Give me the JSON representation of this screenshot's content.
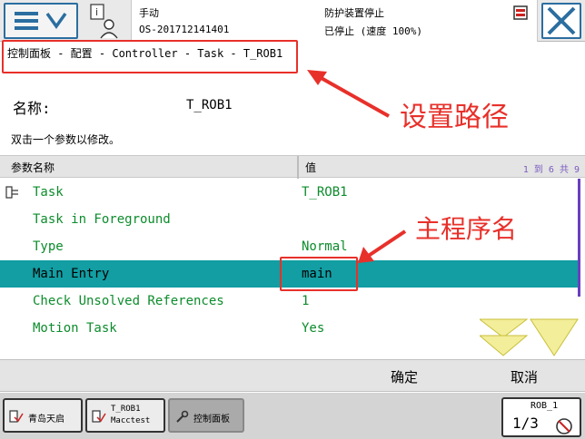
{
  "topbar": {
    "mode": "手动",
    "system_name": "OS-201712141401",
    "safety_status": "防护装置停止",
    "run_status": "已停止 (速度 100%)"
  },
  "breadcrumb": "控制面板 - 配置 - Controller - Task - T_ROB1",
  "instance": {
    "name_label": "名称:",
    "name_value": "T_ROB1",
    "hint": "双击一个参数以修改。"
  },
  "table": {
    "col_name": "参数名称",
    "col_value": "值",
    "count": "1 到 6 共 9",
    "rows": [
      {
        "name": "Task",
        "value": "T_ROB1"
      },
      {
        "name": "Task in Foreground",
        "value": ""
      },
      {
        "name": "Type",
        "value": "Normal"
      },
      {
        "name": "Main Entry",
        "value": "main"
      },
      {
        "name": "Check Unsolved References",
        "value": "1"
      },
      {
        "name": "Motion Task",
        "value": "Yes"
      }
    ]
  },
  "buttons": {
    "ok": "确定",
    "cancel": "取消"
  },
  "taskbar": {
    "task1": "青岛天启",
    "task2_line1": "T_ROB1",
    "task2_line2": "Macctest",
    "task3": "控制面板",
    "quickset_robot": "ROB_1",
    "quickset_fraction": "1/3"
  },
  "annotations": {
    "path_label": "设置路径",
    "main_label": "主程序名"
  },
  "colors": {
    "accent_blue": "#2b6ea0",
    "selected_row": "#129ea3",
    "param_green": "#0c8c2c",
    "annotation_red": "#e8302a",
    "arrow_yellow": "#f3ee9a"
  },
  "icons": [
    "menu-icon",
    "info-user-icon",
    "alarm-icon",
    "close-icon",
    "task-icon",
    "page-down-icon",
    "wrench-icon",
    "quickset-icon"
  ]
}
